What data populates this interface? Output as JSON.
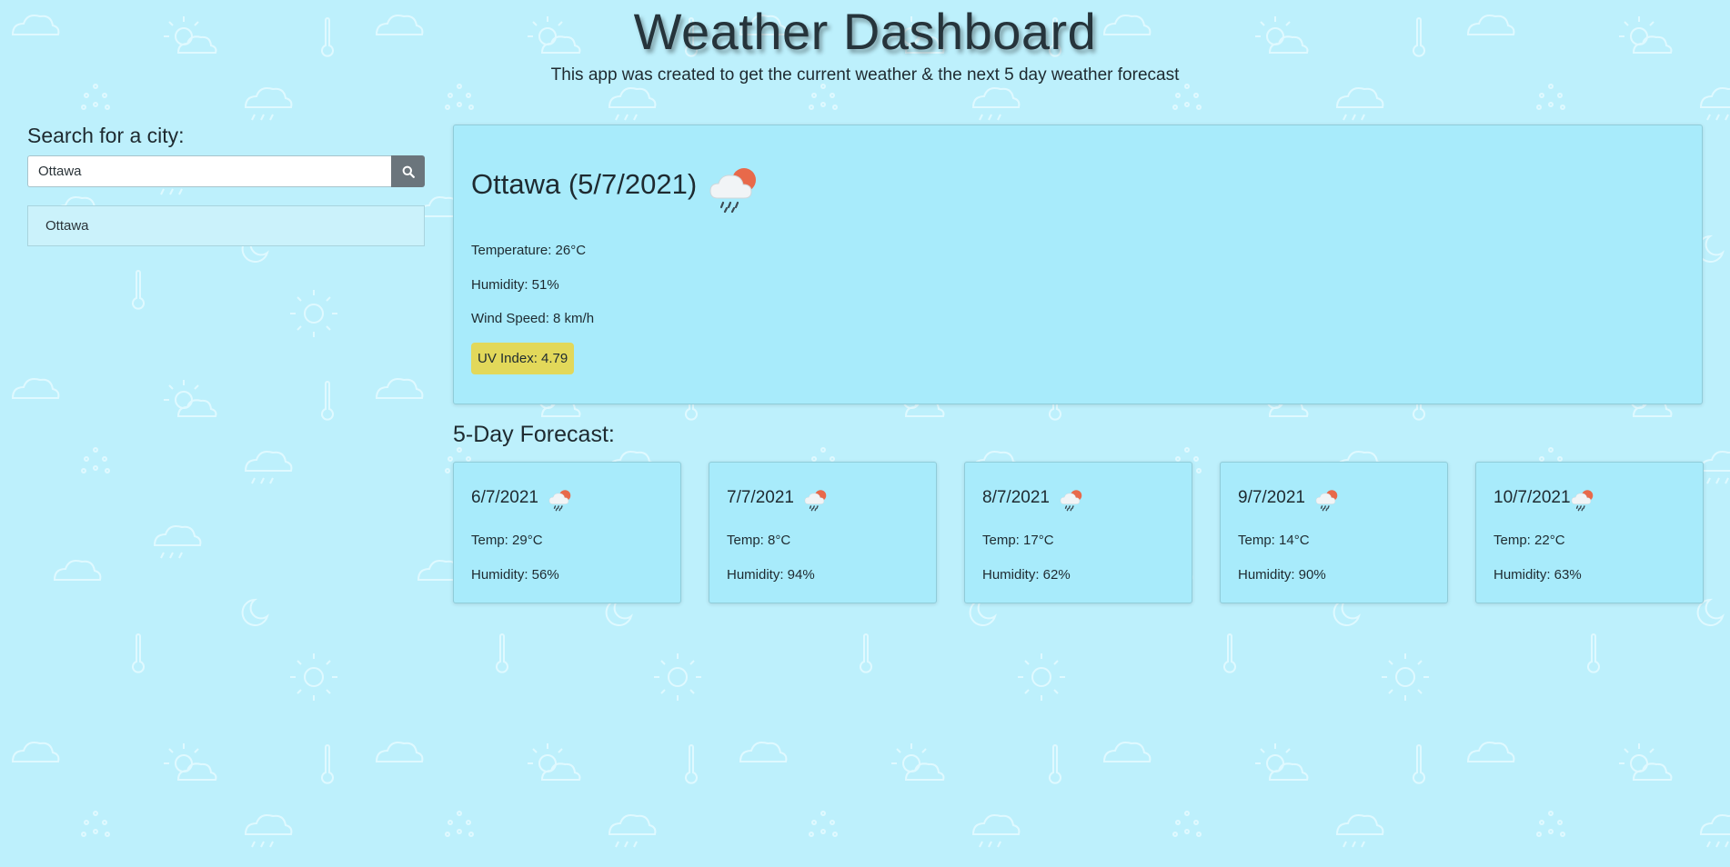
{
  "header": {
    "title": "Weather Dashboard",
    "subtitle": "This app was created to get the current weather & the next 5 day weather forecast"
  },
  "search": {
    "label": "Search for a city:",
    "value": "Ottawa",
    "button_icon": "search-icon"
  },
  "history": [
    {
      "city": "Ottawa"
    }
  ],
  "current": {
    "heading": "Ottawa (5/7/2021)",
    "icon": "rain-cloud-sun-icon",
    "temperature": "Temperature: 26°C",
    "humidity": "Humidity: 51%",
    "wind": "Wind Speed: 8 km/h",
    "uv": "UV Index: 4.79",
    "uv_color": "#e2d85a"
  },
  "forecast": {
    "heading": "5-Day Forecast:",
    "days": [
      {
        "date": "6/7/2021",
        "icon": "rain-cloud-sun-icon",
        "temp": "Temp: 29°C",
        "humidity": "Humidity: 56%"
      },
      {
        "date": "7/7/2021",
        "icon": "rain-cloud-sun-icon",
        "temp": "Temp: 8°C",
        "humidity": "Humidity: 94%"
      },
      {
        "date": "8/7/2021",
        "icon": "rain-cloud-sun-icon",
        "temp": "Temp: 17°C",
        "humidity": "Humidity: 62%"
      },
      {
        "date": "9/7/2021",
        "icon": "rain-cloud-sun-icon",
        "temp": "Temp: 14°C",
        "humidity": "Humidity: 90%"
      },
      {
        "date": "10/7/2021",
        "icon": "rain-cloud-sun-icon",
        "temp": "Temp: 22°C",
        "humidity": "Humidity: 63%"
      }
    ]
  },
  "colors": {
    "background": "#bdf0fc",
    "card": "#a8ebfb",
    "search_button": "#6b757c",
    "weather_sun": "#e8694a"
  }
}
